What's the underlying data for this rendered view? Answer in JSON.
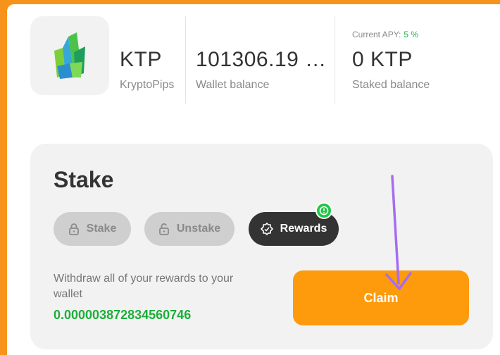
{
  "token": {
    "symbol": "KTP",
    "name": "KryptoPips",
    "logo_icon": "green-crystal-icon"
  },
  "wallet": {
    "value": "101306.19 …",
    "label": "Wallet balance"
  },
  "staked": {
    "apy_label": "Current APY:",
    "apy_value": "5 %",
    "value": "0 KTP",
    "label": "Staked balance"
  },
  "stake_card": {
    "title": "Stake",
    "tabs": [
      {
        "label": "Stake",
        "icon": "lock-icon",
        "active": false
      },
      {
        "label": "Unstake",
        "icon": "unlock-icon",
        "active": false
      },
      {
        "label": "Rewards",
        "icon": "rewards-badge-icon",
        "active": true
      }
    ],
    "description": "Withdraw all of your rewards to your wallet",
    "reward_amount": "0.000003872834560746",
    "claim_label": "Claim"
  },
  "colors": {
    "frame": "#f7931a",
    "accent": "#fd9b0c",
    "green": "#1cae3a",
    "annotation_arrow": "#a66cf0"
  }
}
